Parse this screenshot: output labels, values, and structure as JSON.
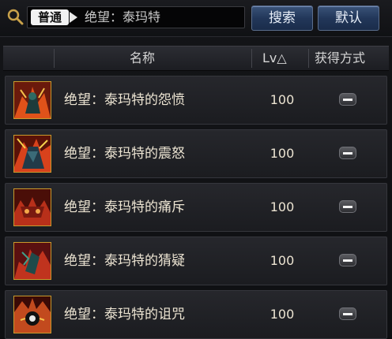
{
  "search": {
    "type_label": "普通",
    "query": "绝望：泰玛特",
    "search_button": "搜索",
    "default_button": "默认"
  },
  "table": {
    "headers": {
      "name": "名称",
      "level": "Lv△",
      "source": "获得方式"
    },
    "rows": [
      {
        "name": "绝望：泰玛特的怨愤",
        "level": "100",
        "icon": "resentment-card-icon"
      },
      {
        "name": "绝望：泰玛特的震怒",
        "level": "100",
        "icon": "fury-card-icon"
      },
      {
        "name": "绝望：泰玛特的痛斥",
        "level": "100",
        "icon": "rebuke-card-icon"
      },
      {
        "name": "绝望：泰玛特的猜疑",
        "level": "100",
        "icon": "suspicion-card-icon"
      },
      {
        "name": "绝望：泰玛特的诅咒",
        "level": "100",
        "icon": "curse-card-icon"
      }
    ]
  },
  "colors": {
    "button_blue": "#22375a",
    "icon_border": "#c89a2c",
    "text": "#ece4d2"
  }
}
